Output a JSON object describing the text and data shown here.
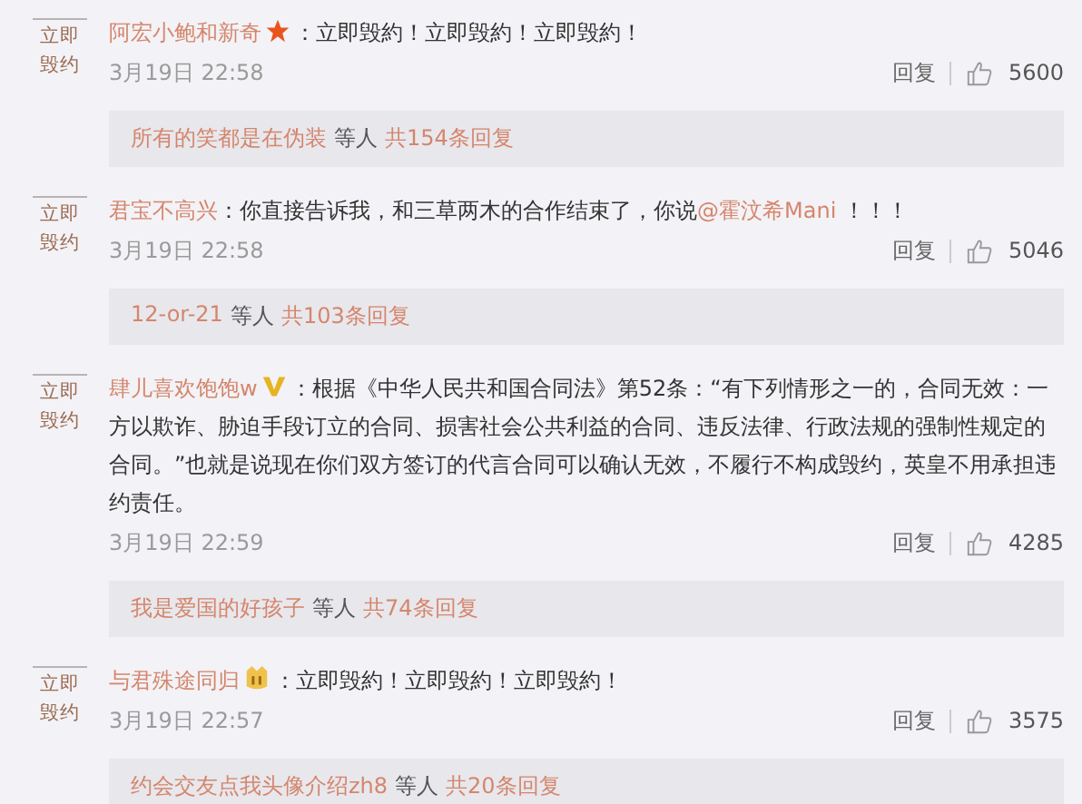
{
  "comments": [
    {
      "avatar": [
        "立即",
        "毁约"
      ],
      "name": "阿宏小鲍和新奇",
      "kind": "star",
      "segments": [
        {
          "kind": "plain",
          "text": "：立即毁約！立即毁約！立即毁約！"
        }
      ],
      "time": "3月19日 22:58",
      "reply": "回复",
      "likes": "5600",
      "thread": {
        "users": "所有的笑都是在伪装",
        "middle": "等人",
        "count": "共154条回复"
      }
    },
    {
      "avatar": [
        "立即",
        "毁约"
      ],
      "name": "君宝不高兴",
      "kind": "plain",
      "segments": [
        {
          "kind": "plain",
          "text": "：你直接告诉我，和三草两木的合作结束了，你说"
        },
        {
          "kind": "mention",
          "text": "@霍汶希Mani"
        },
        {
          "kind": "plain",
          "text": " ！！！"
        }
      ],
      "time": "3月19日 22:58",
      "reply": "回复",
      "likes": "5046",
      "thread": {
        "users": "12-or-21",
        "middle": "等人",
        "count": "共103条回复"
      }
    },
    {
      "avatar": [
        "立即",
        "毁约"
      ],
      "name": "肆儿喜欢饱饱w",
      "kind": "verified",
      "segments": [
        {
          "kind": "plain",
          "text": "：根据《中华人民共和国合同法》第52条：“有下列情形之一的，合同无效：一方以欺诈、胁迫手段订立的合同、损害社会公共利益的合同、违反法律、行政法规的强制性规定的合同。”也就是说现在你们双方签订的代言合同可以确认无效，不履行不构成毁约，英皇不用承担违约责任。"
        }
      ],
      "time": "3月19日 22:59",
      "reply": "回复",
      "likes": "4285",
      "thread": {
        "users": "我是爱国的好孩子",
        "middle": "等人",
        "count": "共74条回复"
      }
    },
    {
      "avatar": [
        "立即",
        "毁约"
      ],
      "name": "与君殊途同归",
      "kind": "medal",
      "segments": [
        {
          "kind": "plain",
          "text": "：立即毁約！立即毁約！立即毁約！"
        }
      ],
      "time": "3月19日 22:57",
      "reply": "回复",
      "likes": "3575",
      "thread": {
        "users": "约会交友点我头像介绍zh8",
        "middle": "等人",
        "count": "共20条回复"
      }
    }
  ]
}
